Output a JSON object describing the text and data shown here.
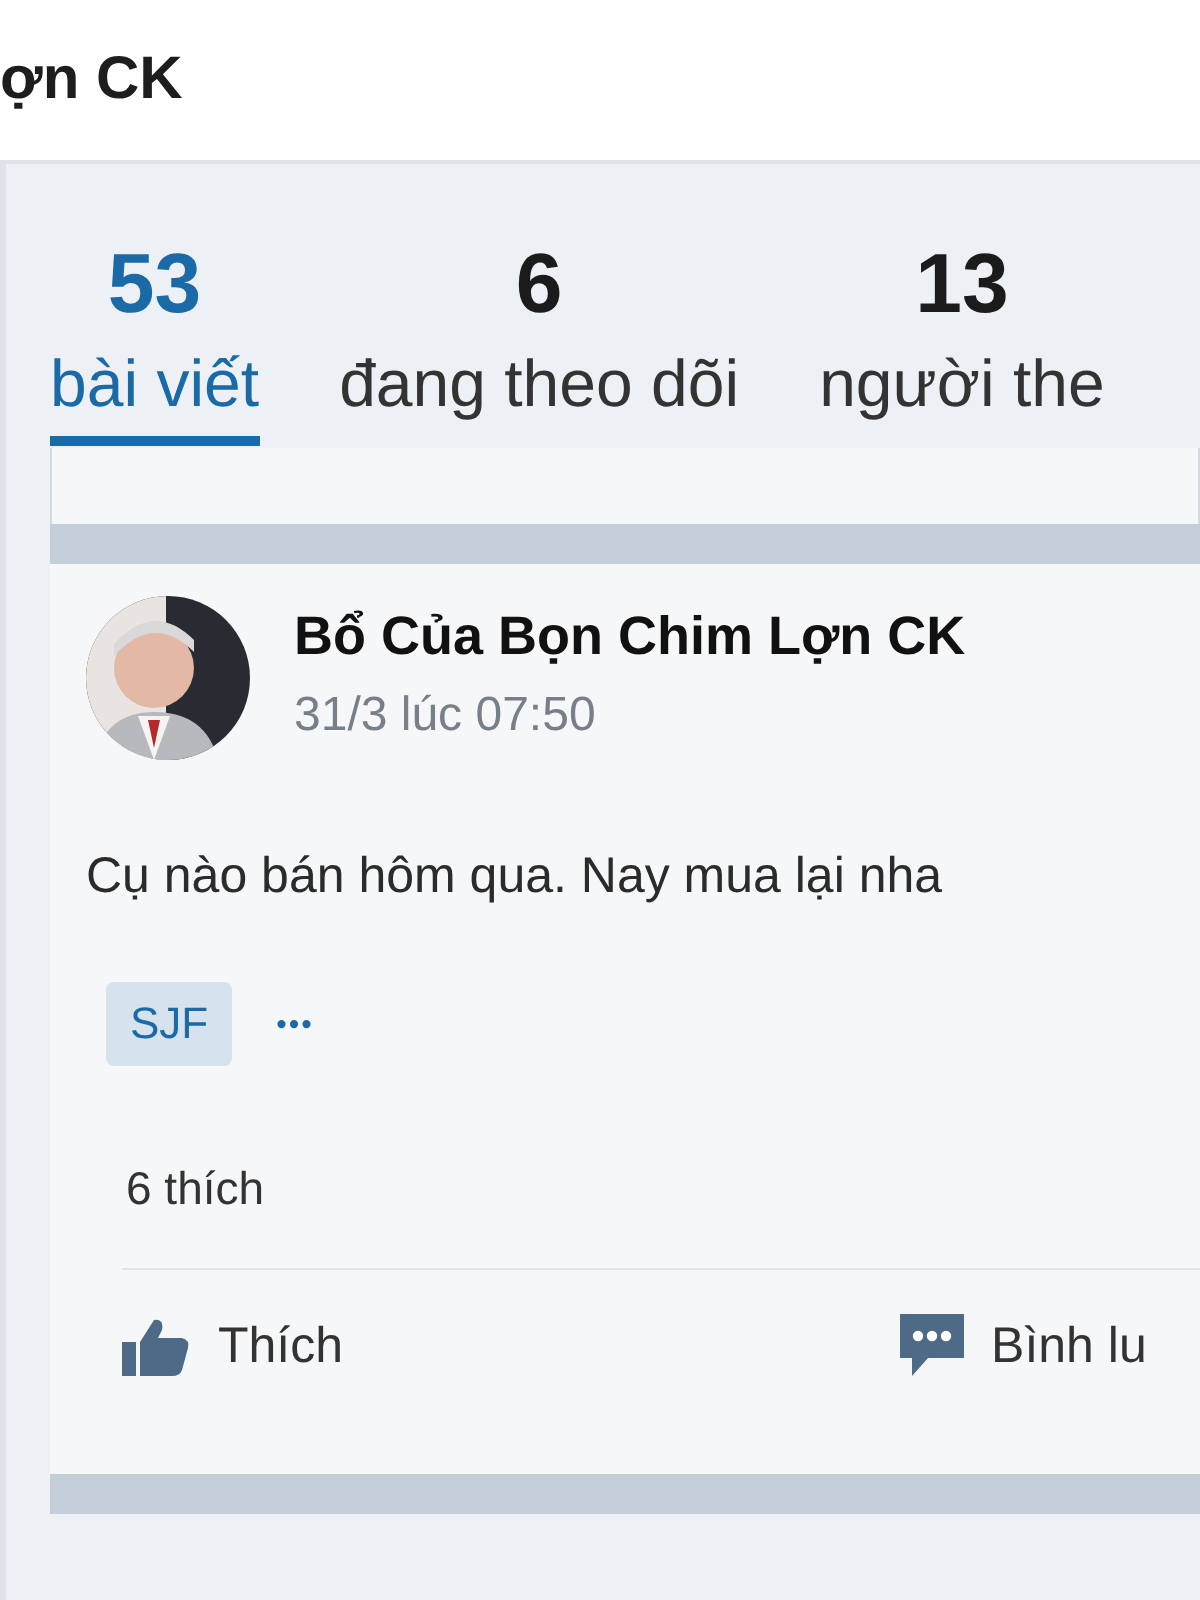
{
  "header": {
    "title": "ợn CK"
  },
  "tabs": [
    {
      "count": "53",
      "label": "bài viết",
      "selected": true
    },
    {
      "count": "6",
      "label": "đang theo dõi",
      "selected": false
    },
    {
      "count": "13",
      "label": "người the",
      "selected": false
    }
  ],
  "post": {
    "author": "Bổ Của Bọn Chim Lợn CK",
    "time": "31/3 lúc 07:50",
    "text": "Cụ nào bán hôm qua. Nay mua lại nha",
    "tags": [
      "SJF"
    ],
    "more": "•••",
    "likes": "6 thích",
    "actions": [
      {
        "kind": "like",
        "label": "Thích"
      },
      {
        "kind": "comment",
        "label": "Bình lu"
      }
    ]
  }
}
